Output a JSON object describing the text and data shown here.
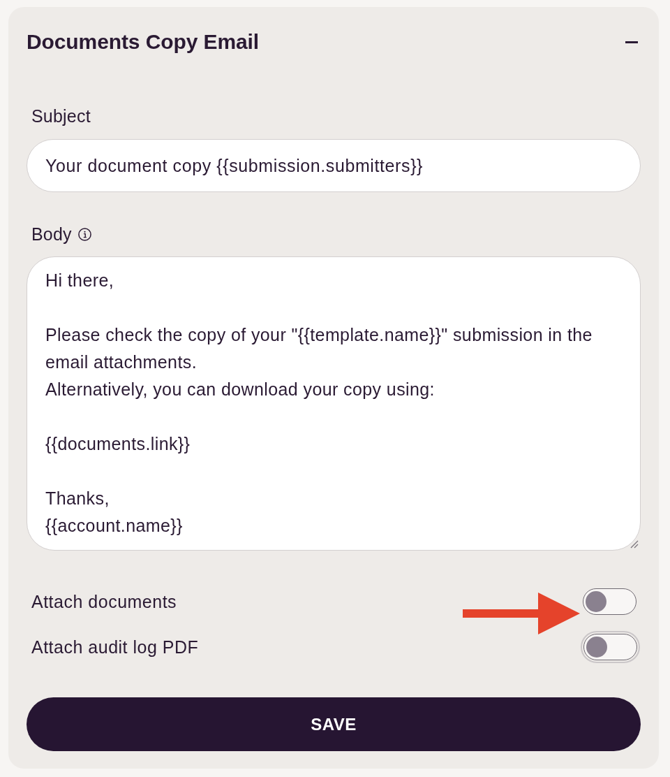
{
  "panel": {
    "title": "Documents Copy Email",
    "expanded": true
  },
  "subject": {
    "label": "Subject",
    "value": "Your document copy {{submission.submitters}}"
  },
  "body": {
    "label": "Body",
    "value": "Hi there,\n\nPlease check the copy of your \"{{template.name}}\" submission in the email attachments.\nAlternatively, you can download your copy using:\n\n{{documents.link}}\n\nThanks,\n{{account.name}}"
  },
  "toggles": [
    {
      "label": "Attach documents",
      "on": false,
      "focused": false,
      "arrow": true
    },
    {
      "label": "Attach audit log PDF",
      "on": false,
      "focused": true,
      "arrow": false
    }
  ],
  "save_button": {
    "label": "SAVE"
  }
}
